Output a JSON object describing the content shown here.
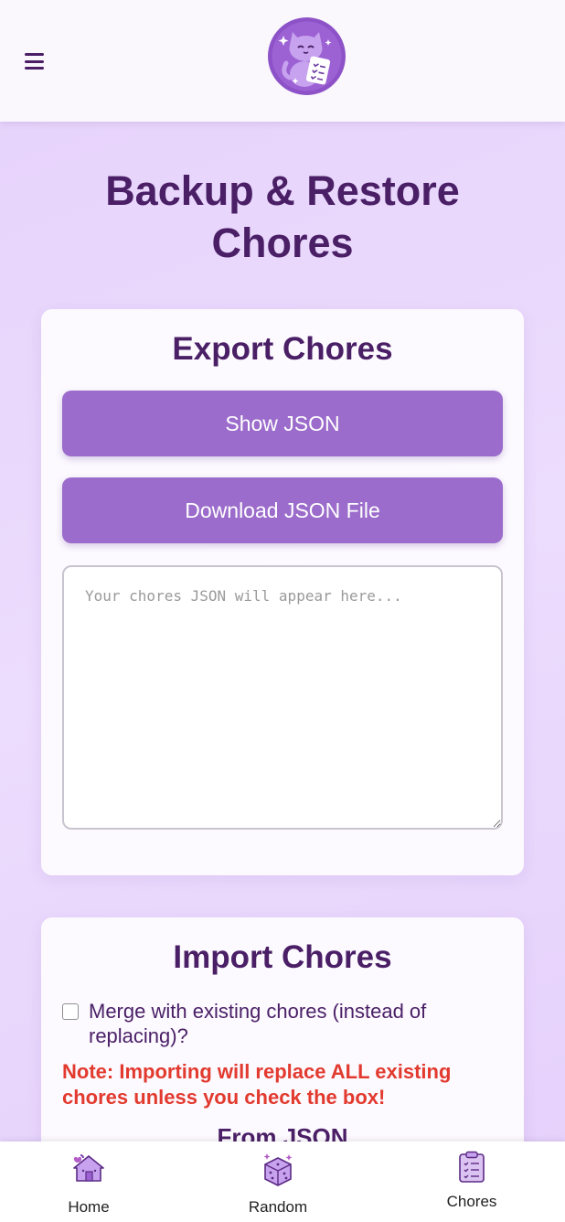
{
  "header": {
    "menu_icon": "hamburger-menu-icon",
    "logo_icon": "cat-with-checklist-logo"
  },
  "page": {
    "title_line1": "Backup & Restore",
    "title_line2": "Chores"
  },
  "export": {
    "title": "Export Chores",
    "show_json_label": "Show JSON",
    "download_label": "Download JSON File",
    "json_value": "",
    "json_placeholder": "Your chores JSON will appear here..."
  },
  "import": {
    "title": "Import Chores",
    "merge_checked": false,
    "merge_label": "Merge with existing chores (instead of replacing)?",
    "note": "Note: Importing will replace ALL existing chores unless you check the box!",
    "from_json_heading": "From JSON"
  },
  "bottom_nav": {
    "items": [
      {
        "label": "Home",
        "icon": "house-icon"
      },
      {
        "label": "Random",
        "icon": "dice-icon"
      },
      {
        "label": "Chores",
        "icon": "clipboard-icon"
      }
    ]
  },
  "colors": {
    "accent": "#9b6ccb",
    "title_text": "#4a1f66",
    "warning": "#e23a2e",
    "background": "#e9d7fc"
  }
}
